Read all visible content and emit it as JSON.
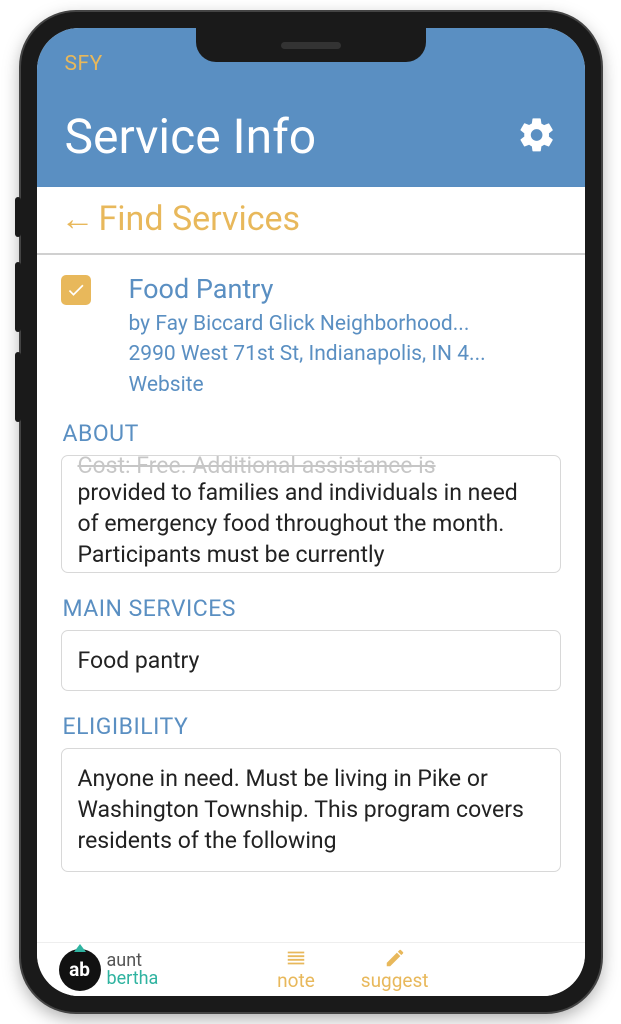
{
  "header": {
    "sfy_label": "SFY",
    "title": "Service Info"
  },
  "nav": {
    "back_label": "Find Services"
  },
  "service": {
    "checked": true,
    "name": "Food Pantry",
    "provider": "by Fay Biccard Glick Neighborhood...",
    "address": "2990 West 71st St, Indianapolis, IN 4...",
    "website_label": "Website"
  },
  "sections": {
    "about": {
      "label": "ABOUT",
      "text": "provided to families and individuals in need of emergency food throughout the month. Participants must be currently"
    },
    "main_services": {
      "label": "MAIN SERVICES",
      "text": "Food pantry"
    },
    "eligibility": {
      "label": "ELIGIBILITY",
      "text": "Anyone in need. Must be living in Pike or Washington Township. This program covers residents of the following"
    }
  },
  "bottom": {
    "brand_badge": "ab",
    "brand_line1": "aunt",
    "brand_line2": "bertha",
    "note_label": "note",
    "suggest_label": "suggest"
  }
}
